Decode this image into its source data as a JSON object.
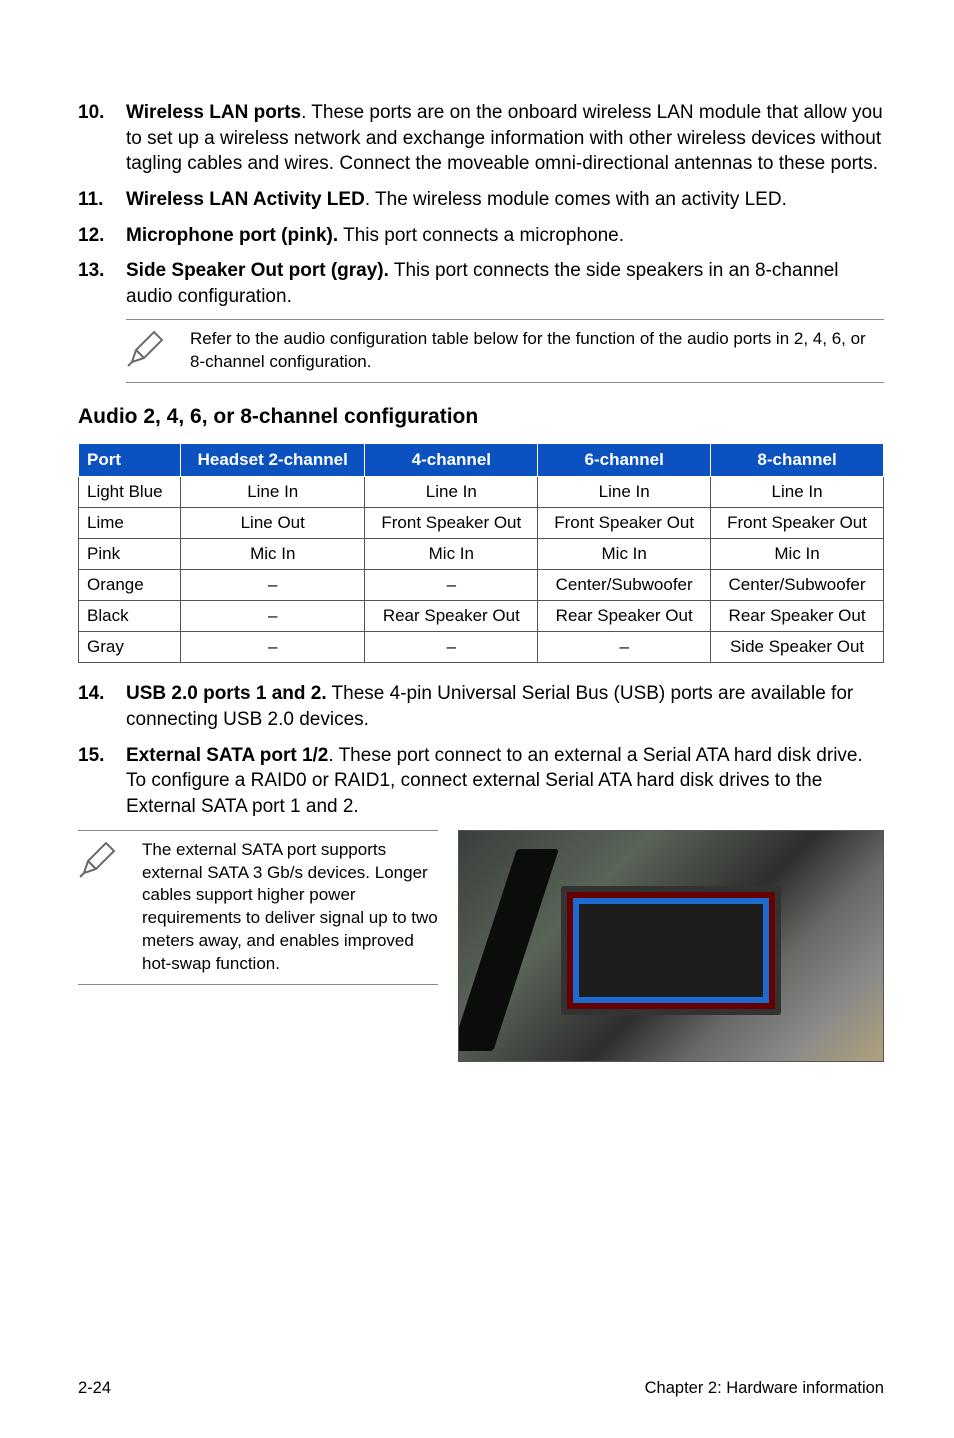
{
  "list1": [
    {
      "num": "10.",
      "bold": "Wireless LAN ports",
      "rest": ". These ports are on the onboard wireless LAN module that allow you to set up a wireless network and exchange information with other wireless devices without tagling cables and wires. Connect the moveable omni-directional antennas to these ports."
    },
    {
      "num": "11.",
      "bold": "Wireless LAN Activity LED",
      "rest": ". The wireless module comes with an activity LED."
    },
    {
      "num": "12.",
      "bold": "Microphone port (pink).",
      "rest": " This port connects a microphone."
    },
    {
      "num": "13.",
      "bold": "Side Speaker Out port (gray).",
      "rest": " This port connects the side speakers in an 8-channel audio configuration."
    }
  ],
  "note1": "Refer to the audio configuration table below for the function of the audio ports in 2, 4, 6, or 8-channel configuration.",
  "section_heading": "Audio 2, 4, 6, or 8-channel configuration",
  "table": {
    "headers": [
      "Port",
      "Headset 2-channel",
      "4-channel",
      "6-channel",
      "8-channel"
    ],
    "rows": [
      [
        "Light Blue",
        "Line In",
        "Line In",
        "Line In",
        "Line In"
      ],
      [
        "Lime",
        "Line Out",
        "Front Speaker Out",
        "Front Speaker Out",
        "Front Speaker Out"
      ],
      [
        "Pink",
        "Mic In",
        "Mic In",
        "Mic In",
        "Mic In"
      ],
      [
        "Orange",
        "–",
        "–",
        "Center/Subwoofer",
        "Center/Subwoofer"
      ],
      [
        "Black",
        "–",
        "Rear Speaker Out",
        "Rear Speaker Out",
        "Rear Speaker Out"
      ],
      [
        "Gray",
        "–",
        "–",
        "–",
        "Side Speaker Out"
      ]
    ]
  },
  "list2": [
    {
      "num": "14.",
      "bold": "USB 2.0 ports 1 and 2.",
      "rest": " These 4-pin Universal Serial Bus (USB) ports are available for connecting USB 2.0 devices."
    },
    {
      "num": "15.",
      "bold": "External SATA port 1/2",
      "rest": ". These port connect to an external a Serial ATA hard disk drive. To configure a RAID0 or RAID1, connect external Serial ATA hard disk drives to the External SATA port 1 and 2."
    }
  ],
  "note2": "The external SATA port supports external SATA 3 Gb/s devices. Longer cables support higher power requirements to deliver signal up to two meters away, and enables improved hot-swap function.",
  "footer": {
    "left": "2-24",
    "right": "Chapter 2: Hardware information"
  }
}
